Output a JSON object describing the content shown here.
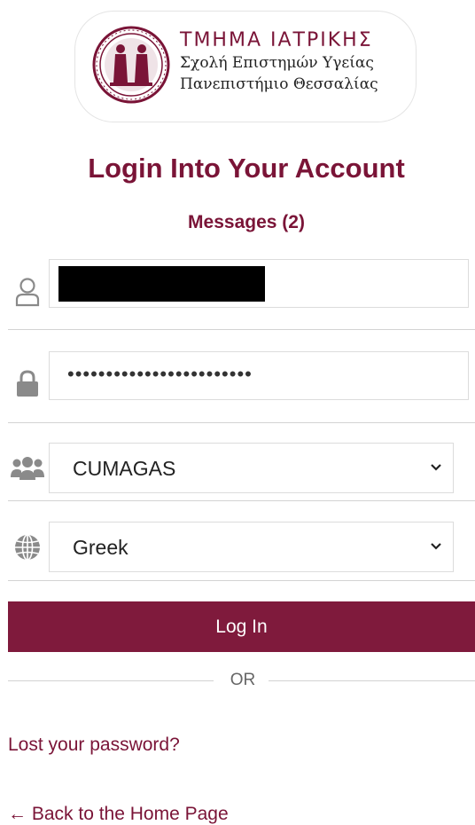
{
  "logo": {
    "line1": "ΤΜΗΜΑ ΙΑΤΡΙΚΗΣ",
    "line2": "Σχολή Επιστημών Υγείας",
    "line3": "Πανεπιστήμιο Θεσσαλίας"
  },
  "page": {
    "title": "Login Into Your Account",
    "messages": "Messages (2)"
  },
  "form": {
    "password_mask": "••••••••••••••••••••••••",
    "group_select": {
      "value": "CUMAGAS"
    },
    "language_select": {
      "value": "Greek"
    },
    "login_button": "Log In",
    "or_separator": "OR"
  },
  "links": {
    "lost_password": "Lost your password?",
    "back_home": "← Back to the Home Page"
  },
  "colors": {
    "brand": "#7f1a3c",
    "icon_gray": "#8a8a8a"
  },
  "icons": [
    "user-icon",
    "lock-icon",
    "users-group-icon",
    "globe-icon",
    "chevron-down-icon"
  ]
}
